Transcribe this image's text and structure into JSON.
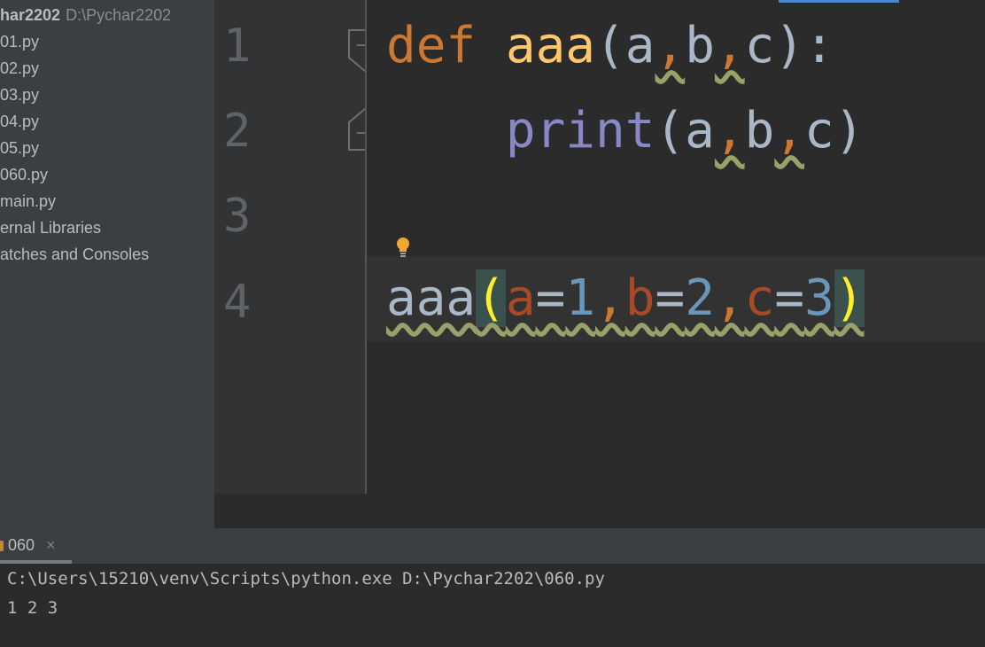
{
  "sidebar": {
    "root_name": "har2202",
    "root_path": "D:\\Pychar2202",
    "items": [
      {
        "label": "01.py"
      },
      {
        "label": "02.py"
      },
      {
        "label": "03.py"
      },
      {
        "label": "04.py"
      },
      {
        "label": "05.py"
      },
      {
        "label": "060.py"
      },
      {
        "label": "main.py"
      },
      {
        "label": "ernal Libraries"
      },
      {
        "label": "atches and Consoles"
      }
    ]
  },
  "editor": {
    "line_numbers": [
      "1",
      "2",
      "3",
      "4"
    ],
    "line1": {
      "kw": "def",
      "fn": "aaa",
      "p1": "(",
      "a": "a",
      "c1": ",",
      "b": "b",
      "c2": ",",
      "c": "c",
      "p2": "):"
    },
    "line2": {
      "fn": "print",
      "p1": "(",
      "a": "a",
      "c1": ",",
      "b": "b",
      "c2": ",",
      "c": "c",
      "p2": ")"
    },
    "line4": {
      "fn": "aaa",
      "open": "(",
      "pa": "a",
      "eq1": "=",
      "v1": "1",
      "c1": ",",
      "pb": "b",
      "eq2": "=",
      "v2": "2",
      "c2": ",",
      "pc": "c",
      "eq3": "=",
      "v3": "3",
      "close": ")"
    }
  },
  "run_panel": {
    "tab_label": "060",
    "close_glyph": "×",
    "console_lines": [
      "C:\\Users\\15210\\venv\\Scripts\\python.exe D:\\Pychar2202\\060.py",
      "1 2 3"
    ]
  },
  "icons": {
    "fold": "fold-icon",
    "bulb": "lightbulb-icon",
    "close": "close-icon"
  },
  "colors": {
    "keyword": "#cc7832",
    "function": "#ffc66d",
    "builtin": "#8888c6",
    "parameter": "#aa4926",
    "number": "#6897bb",
    "bulb": "#f0a732"
  }
}
